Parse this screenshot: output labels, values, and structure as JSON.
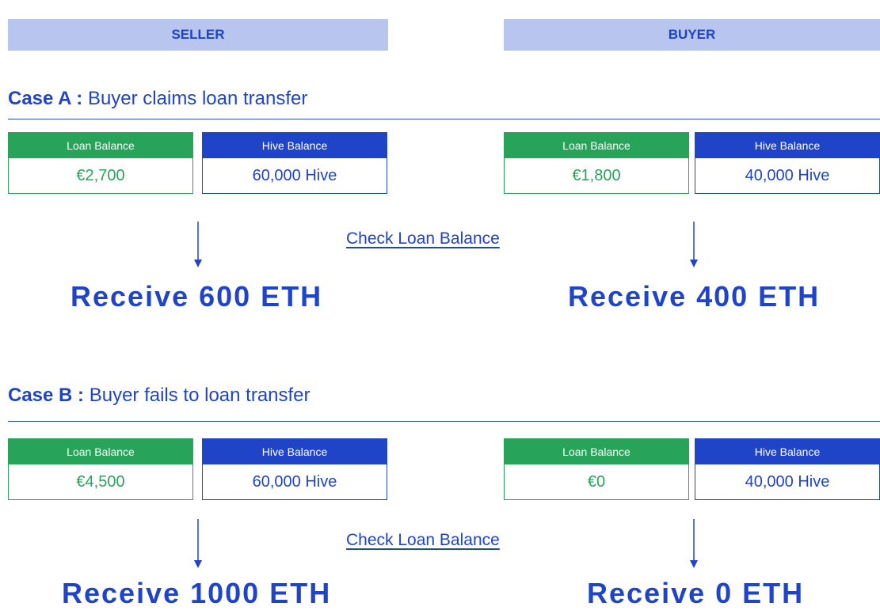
{
  "headers": {
    "seller": "SELLER",
    "buyer": "BUYER"
  },
  "colors": {
    "blue": "#1f44c8",
    "green": "#27a35a",
    "header_bg": "#b8c6ef"
  },
  "cases": [
    {
      "lead": "Case A :",
      "title": "Buyer claims loan transfer",
      "check_link": "Check Loan Balance",
      "seller": {
        "loan_label": "Loan Balance",
        "loan_value": "€2,700",
        "hive_label": "Hive Balance",
        "hive_value": "60,000 Hive",
        "receive": "Receive 600 ETH"
      },
      "buyer": {
        "loan_label": "Loan Balance",
        "loan_value": "€1,800",
        "hive_label": "Hive Balance",
        "hive_value": "40,000 Hive",
        "receive": "Receive 400 ETH"
      }
    },
    {
      "lead": "Case B :",
      "title": "Buyer fails to loan transfer",
      "check_link": "Check Loan Balance",
      "seller": {
        "loan_label": "Loan Balance",
        "loan_value": "€4,500",
        "hive_label": "Hive Balance",
        "hive_value": "60,000 Hive",
        "receive": "Receive 1000 ETH"
      },
      "buyer": {
        "loan_label": "Loan Balance",
        "loan_value": "€0",
        "hive_label": "Hive Balance",
        "hive_value": "40,000 Hive",
        "receive": "Receive 0 ETH"
      }
    }
  ]
}
